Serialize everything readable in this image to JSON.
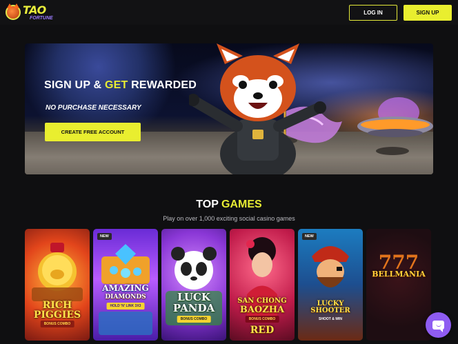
{
  "header": {
    "logo_text": "TAO",
    "logo_sub": "FORTUNE",
    "login_label": "LOG IN",
    "signup_label": "SIGN UP"
  },
  "hero": {
    "title_part1": "SIGN UP & ",
    "title_accent": "GET",
    "title_part2": " REWARDED",
    "subtitle": "NO PURCHASE NECESSARY",
    "cta_label": "CREATE FREE ACCOUNT"
  },
  "games_section": {
    "title_part1": "TOP ",
    "title_accent": "GAMES",
    "subtitle": "Play on over 1,000 exciting social casino games",
    "items": [
      {
        "title_line1": "RICH",
        "title_line2": "PIGGIES",
        "tag": "BONUS COMBO",
        "badge": ""
      },
      {
        "title_line1": "AMAZING",
        "title_line2": "DIAMONDS",
        "tag": "HOLD 'N' LINK 3X3",
        "badge": "NEW"
      },
      {
        "title_line1": "LUCK",
        "title_line2": "PANDA",
        "tag": "BONUS COMBO",
        "badge": ""
      },
      {
        "title_line1": "SAN CHONG",
        "title_line2": "BAOZHA",
        "tag": "BONUS COMBO",
        "extra": "RED",
        "badge": ""
      },
      {
        "title_line1": "LUCKY",
        "title_line2": "SHOOTER",
        "tag": "SHOOT & WIN",
        "badge": "NEW"
      },
      {
        "title_line1": "BELLMANIA",
        "title_line2": "",
        "tag": "",
        "badge": ""
      }
    ]
  },
  "colors": {
    "accent": "#e9ee2f",
    "background": "#0f0f11",
    "chat_button": "#8e5cf2"
  },
  "icons": {
    "chat": "chat-bubble-icon"
  }
}
